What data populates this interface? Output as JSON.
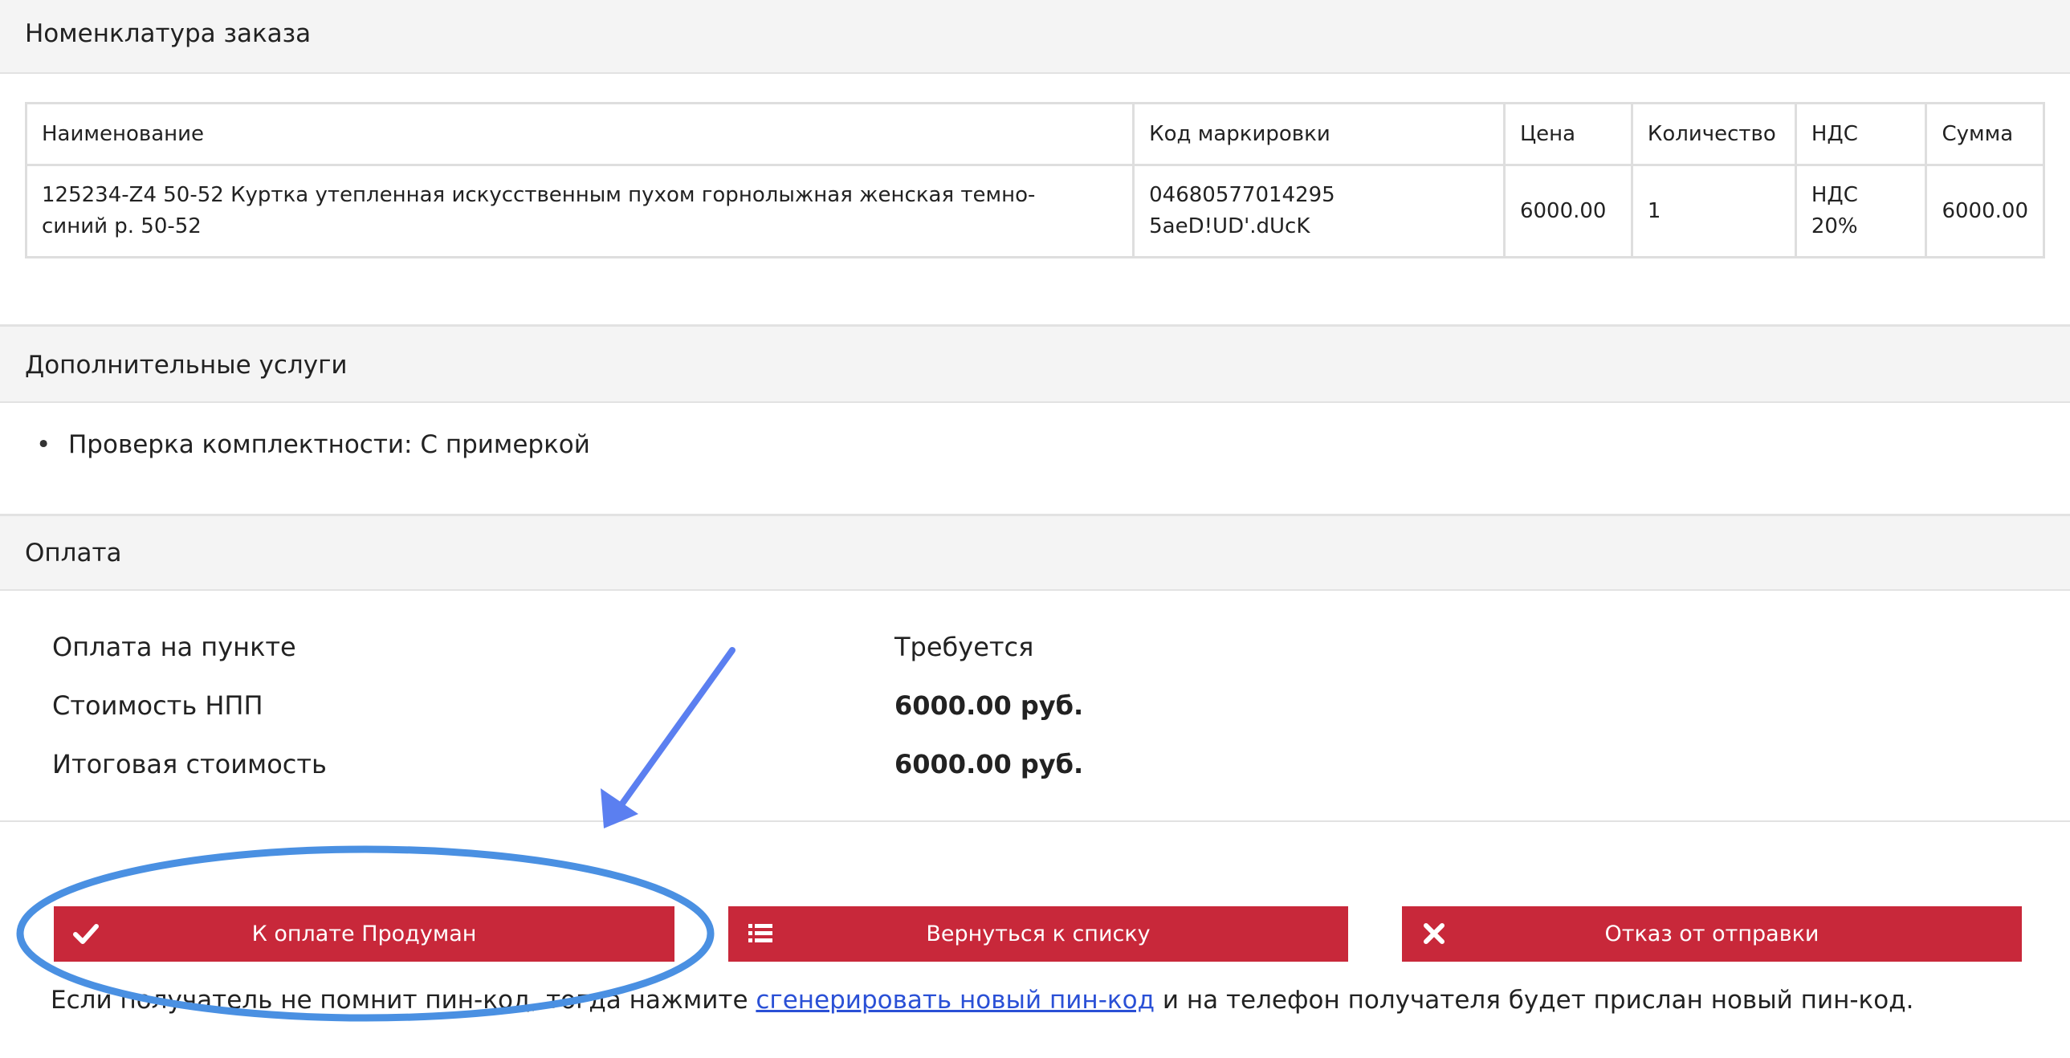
{
  "sections": {
    "nomenclature_title": "Номенклатура заказа",
    "services_title": "Дополнительные услуги",
    "payment_title": "Оплата"
  },
  "table": {
    "headers": [
      "Наименование",
      "Код маркировки",
      "Цена",
      "Количество",
      "НДС",
      "Сумма"
    ],
    "rows": [
      {
        "name_line1": "125234-Z4 50-52 Куртка утепленная искусственным пухом горнолыжная женская темно-",
        "name_line2": "синий р. 50-52",
        "code_line1": "04680577014295",
        "code_line2": "5aeD!UD'.dUcK",
        "price": "6000.00",
        "quantity": "1",
        "vat_line1": "НДС",
        "vat_line2": "20%",
        "sum": "6000.00"
      }
    ]
  },
  "services": {
    "items": [
      "Проверка комплектности: С примеркой"
    ]
  },
  "payment": {
    "rows": [
      {
        "label": "Оплата на пункте",
        "value": "Требуется"
      },
      {
        "label": "Стоимость НПП",
        "value": "6000.00 руб."
      },
      {
        "label": "Итоговая стоимость",
        "value": "6000.00 руб."
      }
    ]
  },
  "buttons": {
    "pay": {
      "label": "К оплате Продуман",
      "icon": "check-icon"
    },
    "back": {
      "label": "Вернуться к списку",
      "icon": "list-icon"
    },
    "refuse": {
      "label": "Отказ от отправки",
      "icon": "close-icon"
    }
  },
  "footer": {
    "before": "Если получатель не помнит пин-код, тогда нажмите ",
    "link": "сгенерировать новый пин-код",
    "after": " и на телефон получателя будет прислан новый пин-код."
  },
  "colors": {
    "button_bg": "#c8283a",
    "link": "#2a50d6",
    "annotation_ellipse": "#4a90e2",
    "annotation_arrow": "#5b7ff0"
  }
}
